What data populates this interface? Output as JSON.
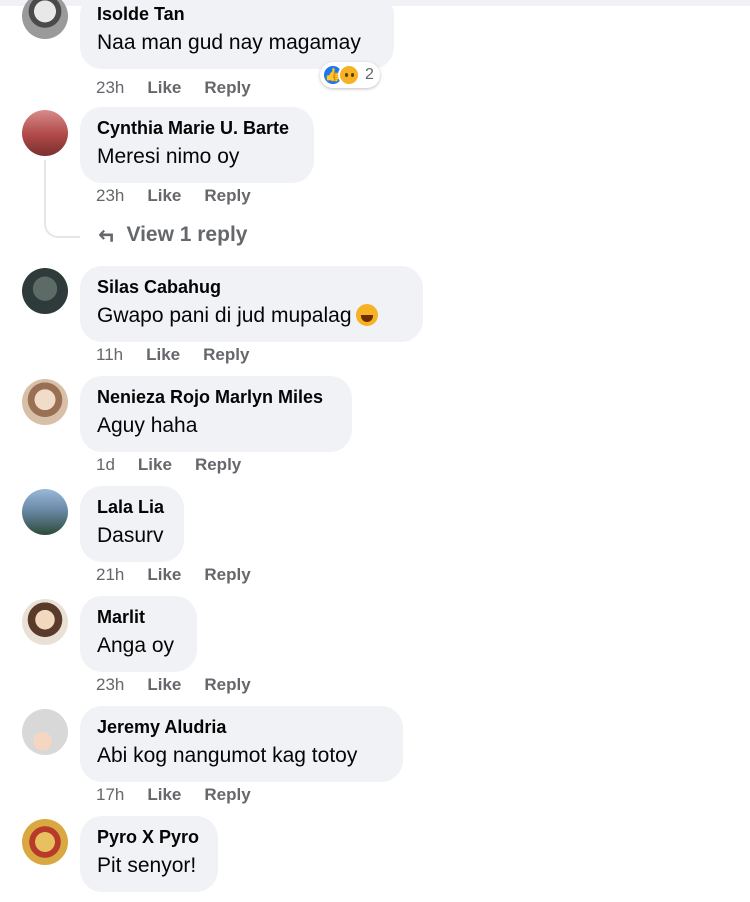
{
  "comments": [
    {
      "author": "Isolde Tan",
      "text": "Naa man gud nay magamay",
      "time": "23h",
      "like": "Like",
      "reply": "Reply",
      "reaction_count": "2",
      "avatar_color": "#6b6b6b"
    },
    {
      "author": "Cynthia Marie U. Barte",
      "text": "Meresi nimo oy",
      "time": "23h",
      "like": "Like",
      "reply": "Reply",
      "avatar_color": "#b85a5a"
    },
    {
      "author": "Silas Cabahug",
      "text": "Gwapo pani di jud mupalag",
      "time": "11h",
      "like": "Like",
      "reply": "Reply",
      "avatar_color": "#3d4a4a"
    },
    {
      "author": "Nenieza Rojo Marlyn Miles",
      "text": "Aguy haha",
      "time": "1d",
      "like": "Like",
      "reply": "Reply",
      "avatar_color": "#c9a98a"
    },
    {
      "author": "Lala Lia",
      "text": "Dasurv",
      "time": "21h",
      "like": "Like",
      "reply": "Reply",
      "avatar_color": "#4a6f8f"
    },
    {
      "author": "Marlit",
      "text": "Anga oy",
      "time": "23h",
      "like": "Like",
      "reply": "Reply",
      "avatar_color": "#d9b9a0"
    },
    {
      "author": "Jeremy Aludria",
      "text": "Abi kog nangumot kag totoy",
      "time": "17h",
      "like": "Like",
      "reply": "Reply",
      "avatar_color": "#c8c8c8"
    },
    {
      "author": "Pyro X Pyro",
      "text": "Pit senyor!",
      "avatar_color": "#c9982f"
    }
  ],
  "view_replies": "View 1 reply",
  "colors": {
    "bubble": "#f0f2f5",
    "meta": "#65676b",
    "like_blue": "#1877f2"
  }
}
